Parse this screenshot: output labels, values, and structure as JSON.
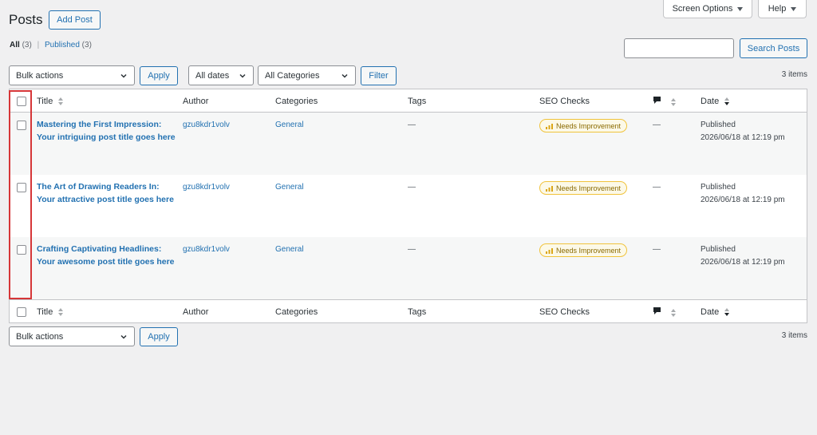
{
  "header": {
    "title": "Posts",
    "add_new": "Add Post"
  },
  "screen_tabs": {
    "screen_options": "Screen Options",
    "help": "Help"
  },
  "views": {
    "all_label": "All",
    "all_count": "(3)",
    "sep": "|",
    "published_label": "Published",
    "published_count": "(3)"
  },
  "search": {
    "value": "",
    "button": "Search Posts"
  },
  "tablenav_top": {
    "bulk_actions": "Bulk actions",
    "apply": "Apply",
    "dates": "All dates",
    "categories": "All Categories",
    "filter": "Filter",
    "items": "3 items"
  },
  "tablenav_bottom": {
    "bulk_actions": "Bulk actions",
    "apply": "Apply",
    "items": "3 items"
  },
  "columns": {
    "title": "Title",
    "author": "Author",
    "categories": "Categories",
    "tags": "Tags",
    "seo": "SEO Checks",
    "date": "Date"
  },
  "posts": [
    {
      "title": "Mastering the First Impression: Your intriguing post title goes here",
      "author": "gzu8kdr1volv",
      "category": "General",
      "tags": "—",
      "seo": "Needs Improvement",
      "comments": "—",
      "status": "Published",
      "date": "2026/06/18 at 12:19 pm"
    },
    {
      "title": "The Art of Drawing Readers In: Your attractive post title goes here",
      "author": "gzu8kdr1volv",
      "category": "General",
      "tags": "—",
      "seo": "Needs Improvement",
      "comments": "—",
      "status": "Published",
      "date": "2026/06/18 at 12:19 pm"
    },
    {
      "title": "Crafting Captivating Headlines: Your awesome post title goes here",
      "author": "gzu8kdr1volv",
      "category": "General",
      "tags": "—",
      "seo": "Needs Improvement",
      "comments": "—",
      "status": "Published",
      "date": "2026/06/18 at 12:19 pm"
    }
  ],
  "colors": {
    "accent": "#2271b1",
    "highlight": "#d63638",
    "badge_border": "#f0c33c"
  }
}
